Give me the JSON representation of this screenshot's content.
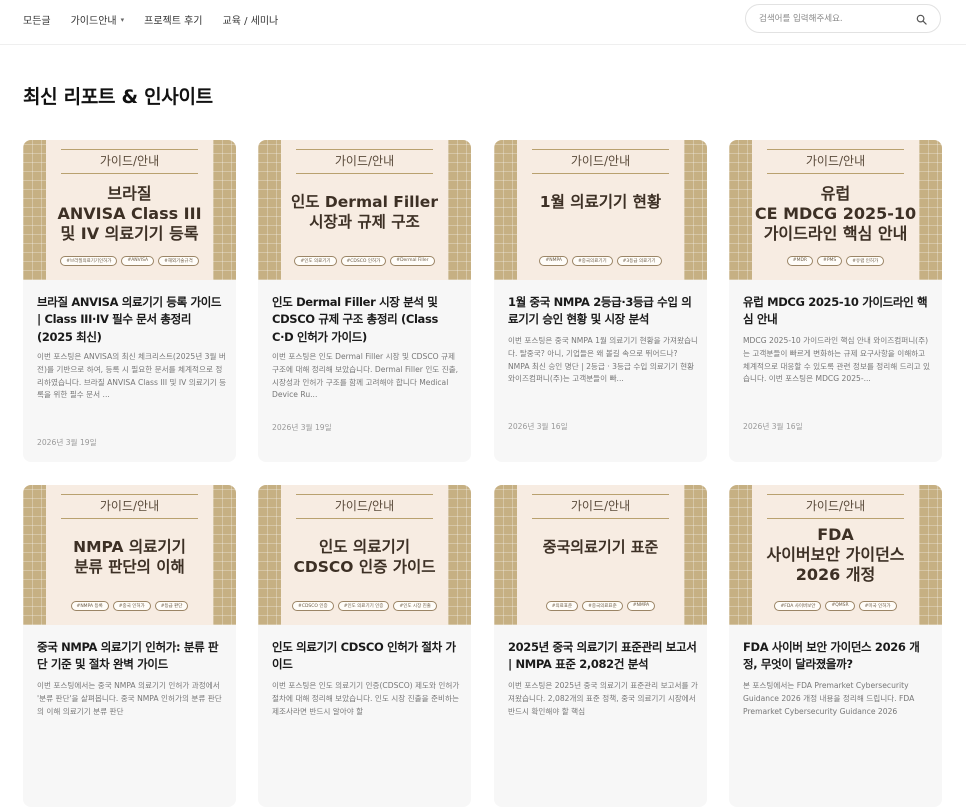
{
  "nav": {
    "items": [
      {
        "label": "모든글",
        "dropdown": false
      },
      {
        "label": "가이드안내",
        "dropdown": true,
        "caret": "▾"
      },
      {
        "label": "프로젝트 후기",
        "dropdown": false
      },
      {
        "label": "교육 / 세미나",
        "dropdown": false
      }
    ]
  },
  "search": {
    "placeholder": "검색어를 입력해주세요.",
    "icon": "search-icon"
  },
  "section_title": "최신 리포트 & 인사이트",
  "colors": {
    "thumb_bg": "#f7ece2",
    "strip": "#c6b083",
    "thumb_text": "#3d3025",
    "card_bg": "#f7f7f7"
  },
  "cards": [
    {
      "thumb_category": "가이드/안내",
      "thumb_lines": [
        "브라질",
        "ANVISA Class III",
        "및 IV 의료기기 등록"
      ],
      "tags": [
        "#브라질의료기기인허가",
        "#ANVISA",
        "#해외기술규격"
      ],
      "title": "브라질 ANVISA 의료기기 등록 가이드 | Class III·IV 필수 문서 총정리 (2025 최신)",
      "desc": "이번 포스팅은 ANVISA의 최신 체크리스트(2025년 3월 버전)를 기반으로 하여, 등록 시 필요한 문서를 체계적으로 정리하였습니다. 브라질 ANVISA Class III 및 IV 의료기기 등록을 위한 필수 문서 ...",
      "date": "2026년 3월 19일"
    },
    {
      "thumb_category": "가이드/안내",
      "thumb_lines": [
        "인도 Dermal Filler",
        "시장과 규제 구조"
      ],
      "tags": [
        "#인도 의료기기",
        "#CDSCO 인허가",
        "#Dermal Filler"
      ],
      "title": "인도 Dermal Filler 시장 분석 및 CDSCO 규제 구조 총정리 (Class C·D 인허가 가이드)",
      "desc": "이번 포스팅은 인도 Dermal Filler 시장 및 CDSCO 규제 구조에 대해 정리해 보았습니다. Dermal Filler 인도 진출, 시장성과 인허가 구조를 함께 고려해야 합니다 Medical Device Ru...",
      "date": "2026년 3월 19일"
    },
    {
      "thumb_category": "가이드/안내",
      "thumb_lines": [
        "1월 의료기기 현황"
      ],
      "tags": [
        "#NMPA",
        "#중국의료기기",
        "#3등급 의료기기"
      ],
      "title": "1월 중국 NMPA 2등급·3등급 수입 의료기기 승인 현황 및 시장 분석",
      "desc": "이번 포스팅은 중국 NMPA 1월 의료기기 현황을 가져왔습니다. 탈중국? 아니, 기업들은 왜 볼길 속으로 뛰어드나? NMPA 최신 승인 명단 | 2등급 · 3등급 수입 의료기기 현황 와이즈컴퍼니(주)는 고객분들이 빠...",
      "date": "2026년 3월 16일"
    },
    {
      "thumb_category": "가이드/안내",
      "thumb_lines": [
        "유럽",
        "CE MDCG 2025-10",
        "가이드라인 핵심 안내"
      ],
      "tags": [
        "#MDR",
        "#PMS",
        "#유럽 인허가"
      ],
      "title": "유럽 MDCG 2025-10 가이드라인 핵심 안내",
      "desc": "MDCG 2025-10 가이드라인 핵심 안내 와이즈컴퍼니(주)는 고객분들이 빠르게 변화하는 규제 요구사항을 이해하고 체계적으로 대응할 수 있도록 관련 정보를 정리해 드리고 있습니다. 이번 포스팅은 MDCG 2025-...",
      "date": "2026년 3월 16일"
    },
    {
      "thumb_category": "가이드/안내",
      "thumb_lines": [
        "NMPA 의료기기",
        "분류 판단의 이해"
      ],
      "tags": [
        "#NMPA 등록",
        "#중국 인허가",
        "#등급 판단"
      ],
      "title": "중국 NMPA 의료기기 인허가: 분류 판단 기준 및 절차 완벽 가이드",
      "desc": "이번 포스팅에서는 중국 NMPA 의료기기 인허가 과정에서 '분류 판단'을 살펴봅니다. 중국 NMPA 인허가의 분류 판단의 이해 의료기기 분류 판단",
      "date": ""
    },
    {
      "thumb_category": "가이드/안내",
      "thumb_lines": [
        "인도 의료기기",
        "CDSCO 인증 가이드"
      ],
      "tags": [
        "#CDSCO 인증",
        "#인도 의료기기 인증",
        "#인도 시장 진출"
      ],
      "title": "인도 의료기기 CDSCO 인허가 절차 가이드",
      "desc": "이번 포스팅은 인도 의료기기 인증(CDSCO) 제도와 인허가 절차에 대해 정리해 보았습니다. 인도 시장 진출을 준비하는 제조사라면 반드시 알아야 할",
      "date": ""
    },
    {
      "thumb_category": "가이드/안내",
      "thumb_lines": [
        "중국의료기기 표준"
      ],
      "tags": [
        "#의료표준",
        "#중국의료표준",
        "#NMPA"
      ],
      "title": "2025년 중국 의료기기 표준관리 보고서 | NMPA 표준 2,082건 분석",
      "desc": "이번 포스팅은 2025년 중국 의료기기 표준관리 보고서를 가져왔습니다. 2,082개의 표준 정책, 중국 의료기기 시장에서 반드시 확인해야 할 핵심",
      "date": ""
    },
    {
      "thumb_category": "가이드/안내",
      "thumb_lines": [
        "FDA",
        "사이버보안 가이던스",
        "2026 개정"
      ],
      "tags": [
        "#FDA 사이버보안",
        "#QMSR",
        "#미국 인허가"
      ],
      "title": "FDA 사이버 보안 가이던스 2026 개정, 무엇이 달라졌을까?",
      "desc": "본 포스팅에서는 FDA Premarket Cybersecurity Guidance 2026 개정 내용을 정리해 드립니다. FDA Premarket Cybersecurity Guidance 2026",
      "date": ""
    }
  ]
}
